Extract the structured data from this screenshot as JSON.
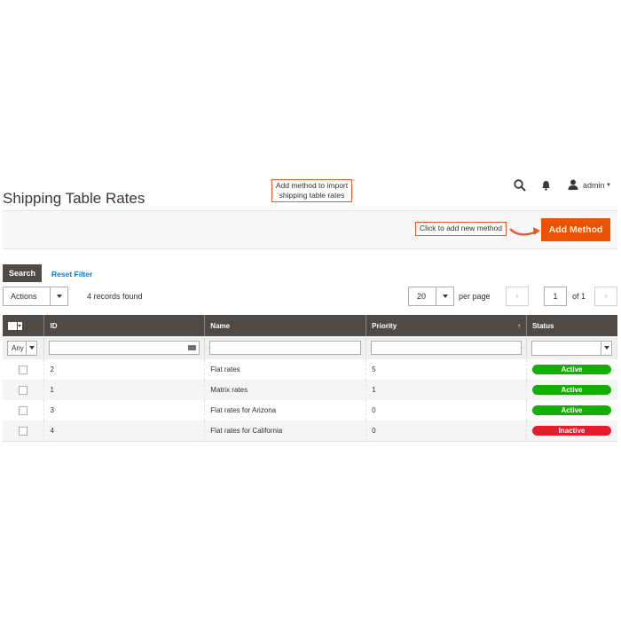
{
  "header": {
    "title": "Shipping Table Rates",
    "user": "admin"
  },
  "callouts": {
    "import": "Add method to import shipping table rates",
    "add": "Click to add new method"
  },
  "actions": {
    "add_method_label": "Add Method"
  },
  "filters": {
    "search_label": "Search",
    "reset_label": "Reset Filter",
    "any_option": "Any"
  },
  "toolbar": {
    "actions_label": "Actions",
    "records_found": "4 records found",
    "per_page_value": "20",
    "per_page_label": "per page",
    "current_page": "1",
    "of_pages": "of 1"
  },
  "grid": {
    "columns": [
      "ID",
      "Name",
      "Priority",
      "Status"
    ],
    "rows": [
      {
        "id": "2",
        "name": "Flat rates",
        "priority": "5",
        "status": "Active"
      },
      {
        "id": "1",
        "name": "Matrix rates",
        "priority": "1",
        "status": "Active"
      },
      {
        "id": "3",
        "name": "Flat rates for Arizona",
        "priority": "0",
        "status": "Active"
      },
      {
        "id": "4",
        "name": "Flat rates for California",
        "priority": "0",
        "status": "Inactive"
      }
    ]
  },
  "colors": {
    "accent": "#eb5202",
    "header_bg": "#514943",
    "active": "#15ae05",
    "inactive": "#e41c2c",
    "link": "#007bdb"
  }
}
